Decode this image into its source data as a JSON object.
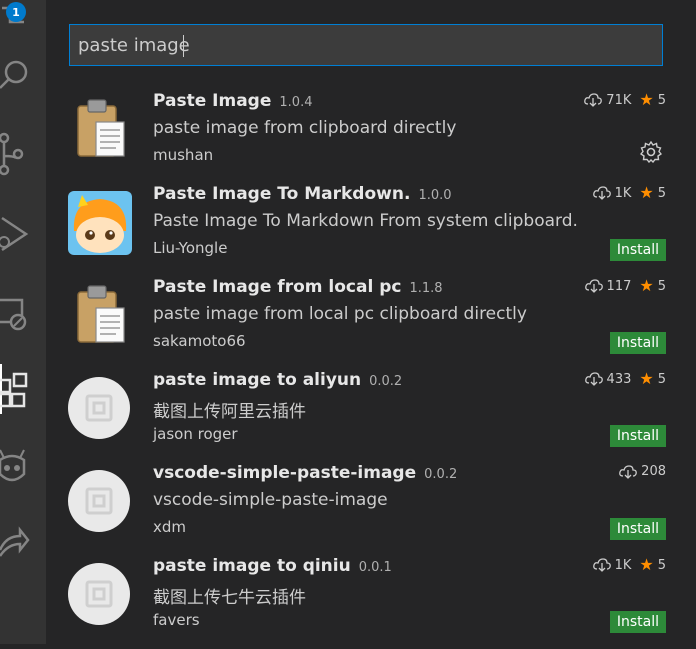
{
  "activity_bar": {
    "badge_count": "1",
    "icons": [
      "extensions-badge-icon",
      "search-icon",
      "source-control-icon",
      "run-debug-icon",
      "remote-explorer-icon",
      "extensions-icon",
      "alien-icon",
      "live-share-icon"
    ]
  },
  "search": {
    "value": "paste image"
  },
  "extensions": [
    {
      "name": "Paste Image",
      "version": "1.0.4",
      "description": "paste image from clipboard directly",
      "publisher": "mushan",
      "downloads": "71K",
      "rating": "5",
      "installed": true,
      "icon": "clipboard-icon"
    },
    {
      "name": "Paste Image To Markdown.",
      "version": "1.0.0",
      "description": "Paste Image To Markdown From system clipboard.",
      "publisher": "Liu-Yongle",
      "downloads": "1K",
      "rating": "5",
      "install_label": "Install",
      "icon": "cartoon-avatar-icon"
    },
    {
      "name": "Paste Image from local pc",
      "version": "1.1.8",
      "description": "paste image from local pc clipboard directly",
      "publisher": "sakamoto66",
      "downloads": "117",
      "rating": "5",
      "install_label": "Install",
      "icon": "clipboard-icon"
    },
    {
      "name": "paste image to aliyun",
      "version": "0.0.2",
      "description": "截图上传阿里云插件",
      "publisher": "jason roger",
      "downloads": "433",
      "rating": "5",
      "install_label": "Install",
      "icon": "default-extension-icon"
    },
    {
      "name": "vscode-simple-paste-image",
      "version": "0.0.2",
      "description": "vscode-simple-paste-image",
      "publisher": "xdm",
      "downloads": "208",
      "rating": "",
      "install_label": "Install",
      "icon": "default-extension-icon"
    },
    {
      "name": "paste image to qiniu",
      "version": "0.0.1",
      "description": "截图上传七牛云插件",
      "publisher": "favers",
      "downloads": "1K",
      "rating": "5",
      "install_label": "Install",
      "icon": "default-extension-icon"
    }
  ],
  "colors": {
    "accent": "#007acc",
    "install_button": "#2d8a39",
    "star": "#ff8e00",
    "background": "#252526",
    "activity_bar": "#333333"
  }
}
